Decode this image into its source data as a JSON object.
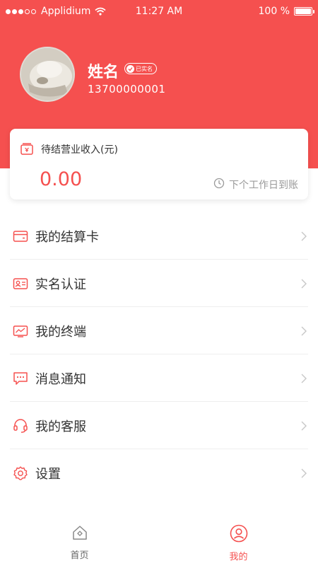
{
  "status_bar": {
    "carrier": "Applidium",
    "time": "11:27 AM",
    "battery": "100 %",
    "battery_level": 1.0
  },
  "profile": {
    "name": "姓名",
    "verified_label": "已实名",
    "phone": "13700000001"
  },
  "income_card": {
    "title": "待结营业收入(元)",
    "amount": "0.00",
    "settle_note": "下个工作日到账"
  },
  "menu": {
    "items": [
      {
        "label": "我的结算卡",
        "icon": "bank-card-icon"
      },
      {
        "label": "实名认证",
        "icon": "id-card-icon"
      },
      {
        "label": "我的终端",
        "icon": "terminal-icon"
      },
      {
        "label": "消息通知",
        "icon": "message-icon"
      },
      {
        "label": "我的客服",
        "icon": "headset-icon"
      },
      {
        "label": "设置",
        "icon": "gear-icon"
      }
    ]
  },
  "tab_bar": {
    "home_label": "首页",
    "me_label": "我的",
    "active": "me"
  },
  "colors": {
    "accent": "#f5504f",
    "text": "#333333",
    "muted": "#999999",
    "divider": "#eeeeee"
  }
}
